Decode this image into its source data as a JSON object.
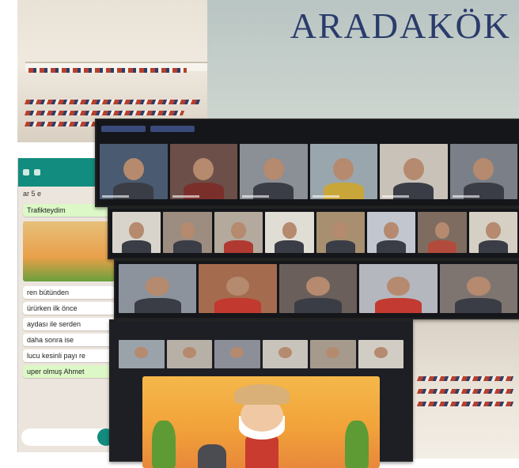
{
  "banner": {
    "title": "ARADAKÖK"
  },
  "chat": {
    "contact": "ar 5 e",
    "messages": [
      {
        "text": "Trafikteydim",
        "direction": "out"
      },
      {
        "text": "ren bütünden",
        "direction": "in"
      },
      {
        "text": "ürürken ilk önce",
        "direction": "in"
      },
      {
        "text": "aydası ile serden",
        "direction": "in"
      },
      {
        "text": "daha sonra ise",
        "direction": "in"
      },
      {
        "text": "lucu kesinli payı re",
        "direction": "in"
      },
      {
        "text": "uper olmuş Ahmet",
        "direction": "out"
      }
    ]
  },
  "colors": {
    "banner_text": "#2a3b6b",
    "chat_header": "#128c7e",
    "meet_bar": "#15161a"
  },
  "icons": [
    "phone-icon",
    "video-icon",
    "mic-icon",
    "camera-icon"
  ]
}
